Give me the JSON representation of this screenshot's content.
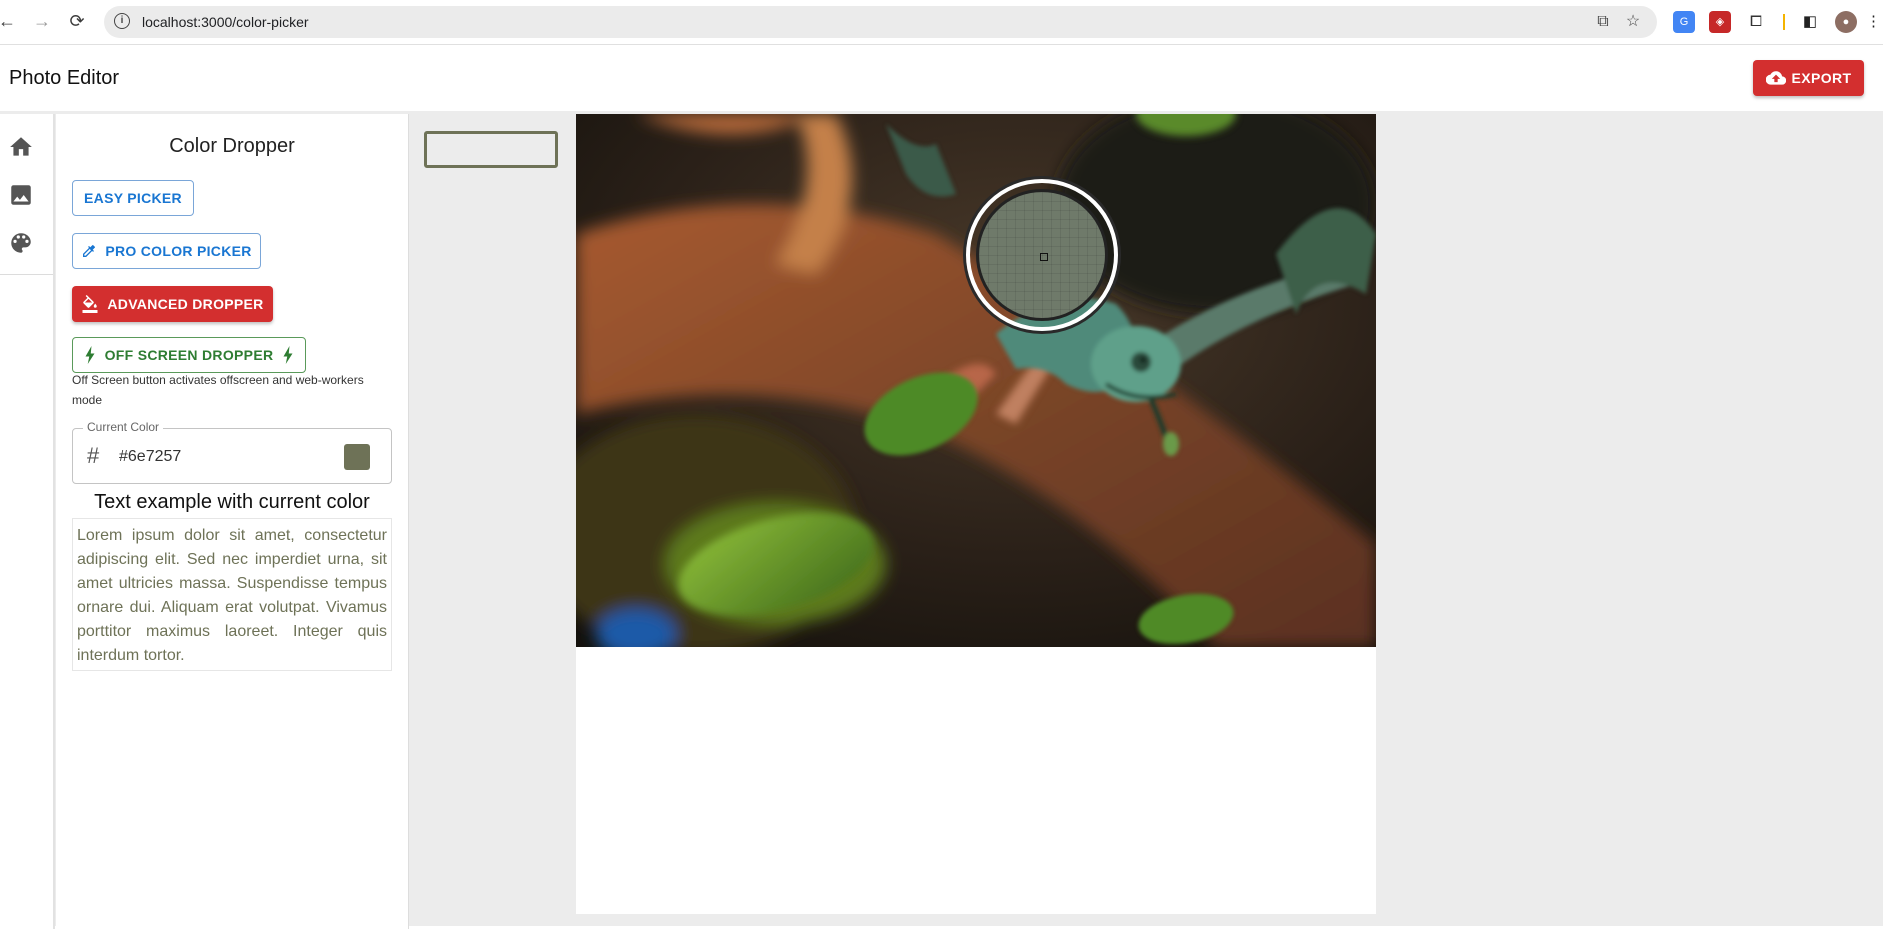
{
  "browser": {
    "url": "localhost:3000/color-picker"
  },
  "app": {
    "title": "Photo Editor",
    "export_label": "EXPORT",
    "accent_color": "#d32f2f"
  },
  "rail": {
    "items": [
      {
        "icon": "home-icon"
      },
      {
        "icon": "image-icon"
      },
      {
        "icon": "palette-icon"
      }
    ]
  },
  "panel": {
    "title": "Color Dropper",
    "buttons": {
      "easy": "EASY PICKER",
      "pro": "PRO COLOR PICKER",
      "advanced": "ADVANCED DROPPER",
      "offscreen": "OFF SCREEN DROPPER"
    },
    "hint": "Off Screen button activates offscreen and web-workers mode",
    "current_color": {
      "legend": "Current Color",
      "value": "#6e7257",
      "hex": "#6e7257"
    },
    "text_example_title": "Text example with current color",
    "lorem": "Lorem ipsum dolor sit amet, consectetur adipiscing elit. Sed nec imperdiet urna, sit amet ultricies massa. Suspendisse tempus ornare dui. Aliquam erat volutpat. Vivamus porttitor maximus laoreet. Integer quis interdum tortor."
  },
  "loupe": {
    "sampled_color": "#6f7a6a"
  }
}
